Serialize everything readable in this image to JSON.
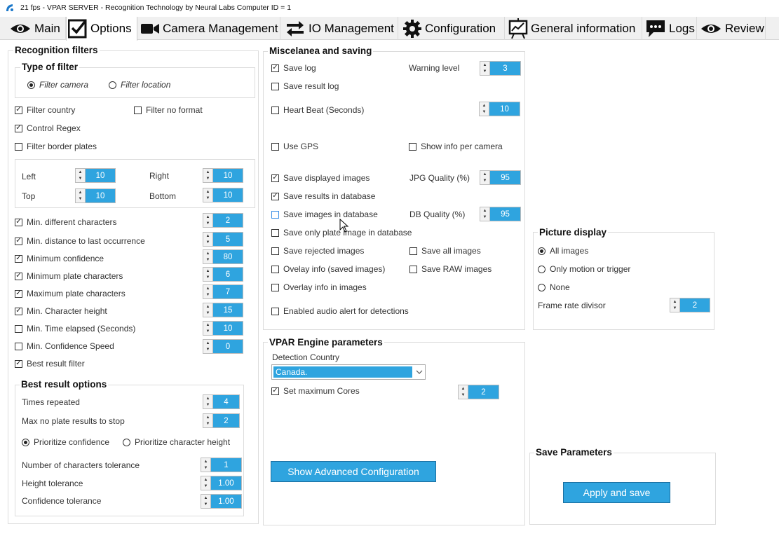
{
  "window": {
    "title": "21 fps - VPAR SERVER - Recognition Technology by Neural Labs Computer ID  = 1"
  },
  "tabs": [
    {
      "label": "Main",
      "icon": "eye-icon"
    },
    {
      "label": "Options",
      "icon": "checkbox-icon"
    },
    {
      "label": "Camera Management",
      "icon": "video-camera-icon"
    },
    {
      "label": "IO Management",
      "icon": "arrows-exchange-icon"
    },
    {
      "label": "Configuration",
      "icon": "gear-icon"
    },
    {
      "label": "General information",
      "icon": "chart-board-icon"
    },
    {
      "label": "Logs",
      "icon": "chat-bubble-icon"
    },
    {
      "label": "Review",
      "icon": "eye-icon"
    }
  ],
  "active_tab": "Options",
  "recognition": {
    "title": "Recognition filters",
    "type_title": "Type of filter",
    "filter_camera": "Filter camera",
    "filter_location": "Filter location",
    "filter_country": "Filter country",
    "filter_no_format": "Filter no format",
    "control_regex": "Control Regex",
    "filter_border": "Filter border plates",
    "border": {
      "left": "Left",
      "left_val": "10",
      "right": "Right",
      "right_val": "10",
      "top": "Top",
      "top_val": "10",
      "bottom": "Bottom",
      "bottom_val": "10"
    },
    "options": [
      {
        "label": "Min. different characters",
        "value": "2",
        "checked": true
      },
      {
        "label": "Min. distance to last occurrence",
        "value": "5",
        "checked": true
      },
      {
        "label": "Minimum confidence",
        "value": "80",
        "checked": true
      },
      {
        "label": "Minimum plate characters",
        "value": "6",
        "checked": true
      },
      {
        "label": "Maximum plate characters",
        "value": "7",
        "checked": true
      },
      {
        "label": "Min. Character height",
        "value": "15",
        "checked": true
      },
      {
        "label": "Min. Time elapsed (Seconds)",
        "value": "10",
        "checked": false
      },
      {
        "label": "Min. Confidence Speed",
        "value": "0",
        "checked": false
      }
    ],
    "best_result_filter": "Best result filter"
  },
  "best": {
    "title": "Best result options",
    "times_repeated": "Times repeated",
    "times_repeated_val": "4",
    "max_no_plate": "Max no plate results to stop",
    "max_no_plate_val": "2",
    "prio_conf": "Prioritize confidence",
    "prio_height": "Prioritize character height",
    "num_chars_tol": "Number of characters tolerance",
    "num_chars_tol_val": "1",
    "height_tol": "Height tolerance",
    "height_tol_val": "1.00",
    "conf_tol": "Confidence tolerance",
    "conf_tol_val": "1.00"
  },
  "misc": {
    "title": "Miscelanea and saving",
    "save_log": "Save log",
    "warning_level": "Warning level",
    "warning_level_val": "3",
    "save_result_log": "Save result log",
    "heart_beat": "Heart Beat (Seconds)",
    "heart_beat_val": "10",
    "use_gps": "Use GPS",
    "show_info_cam": "Show info per camera",
    "save_displayed": "Save displayed images",
    "jpg_quality": "JPG Quality (%)",
    "jpg_quality_val": "95",
    "save_results_db": "Save results in database",
    "save_images_db": "Save images in database",
    "db_quality": "DB Quality (%)",
    "db_quality_val": "95",
    "save_plate_db": "Save only plate image in database",
    "save_rejected": "Save rejected images",
    "save_all": "Save all images",
    "overlay_saved": "Ovelay info (saved images)",
    "save_raw": "Save RAW images",
    "overlay_images": "Overlay info in images",
    "audio_alert": "Enabled audio alert for detections"
  },
  "engine": {
    "title": "VPAR Engine parameters",
    "detection_country": "Detection Country",
    "country_val": "Canada.",
    "set_max_cores": "Set maximum Cores",
    "cores_val": "2",
    "advanced_btn": "Show Advanced Configuration"
  },
  "picture": {
    "title": "Picture display",
    "all_images": "All images",
    "motion_trigger": "Only motion or trigger",
    "none": "None",
    "frame_rate": "Frame rate divisor",
    "frame_rate_val": "2"
  },
  "save": {
    "title": "Save Parameters",
    "apply": "Apply and save"
  },
  "colors": {
    "accent": "#2fa4df",
    "border": "#dcdcdc"
  }
}
